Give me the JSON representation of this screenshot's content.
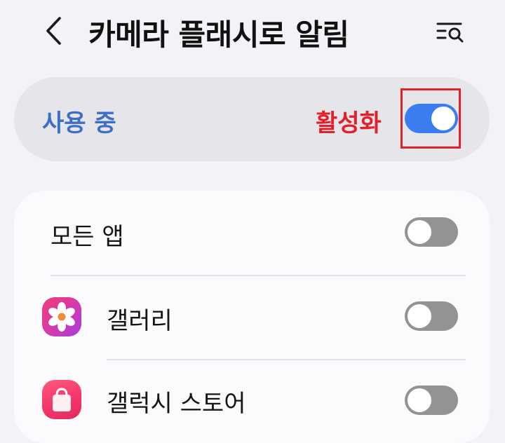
{
  "header": {
    "title": "카메라 플래시로 알림",
    "back_icon": "chevron-left-icon",
    "search_icon": "list-search-icon"
  },
  "master": {
    "label": "사용 중",
    "annotation": "활성화",
    "enabled": true,
    "label_color": "#3e6fc6",
    "annotation_color": "#e1202a",
    "toggle_on_color": "#3b7cf0"
  },
  "list": {
    "all_apps": {
      "label": "모든 앱",
      "enabled": false
    },
    "apps": [
      {
        "label": "갤러리",
        "icon": "gallery-flower-icon",
        "enabled": false
      },
      {
        "label": "갤럭시 스토어",
        "icon": "galaxy-store-bag-icon",
        "enabled": false
      }
    ],
    "toggle_off_color": "#939396"
  }
}
